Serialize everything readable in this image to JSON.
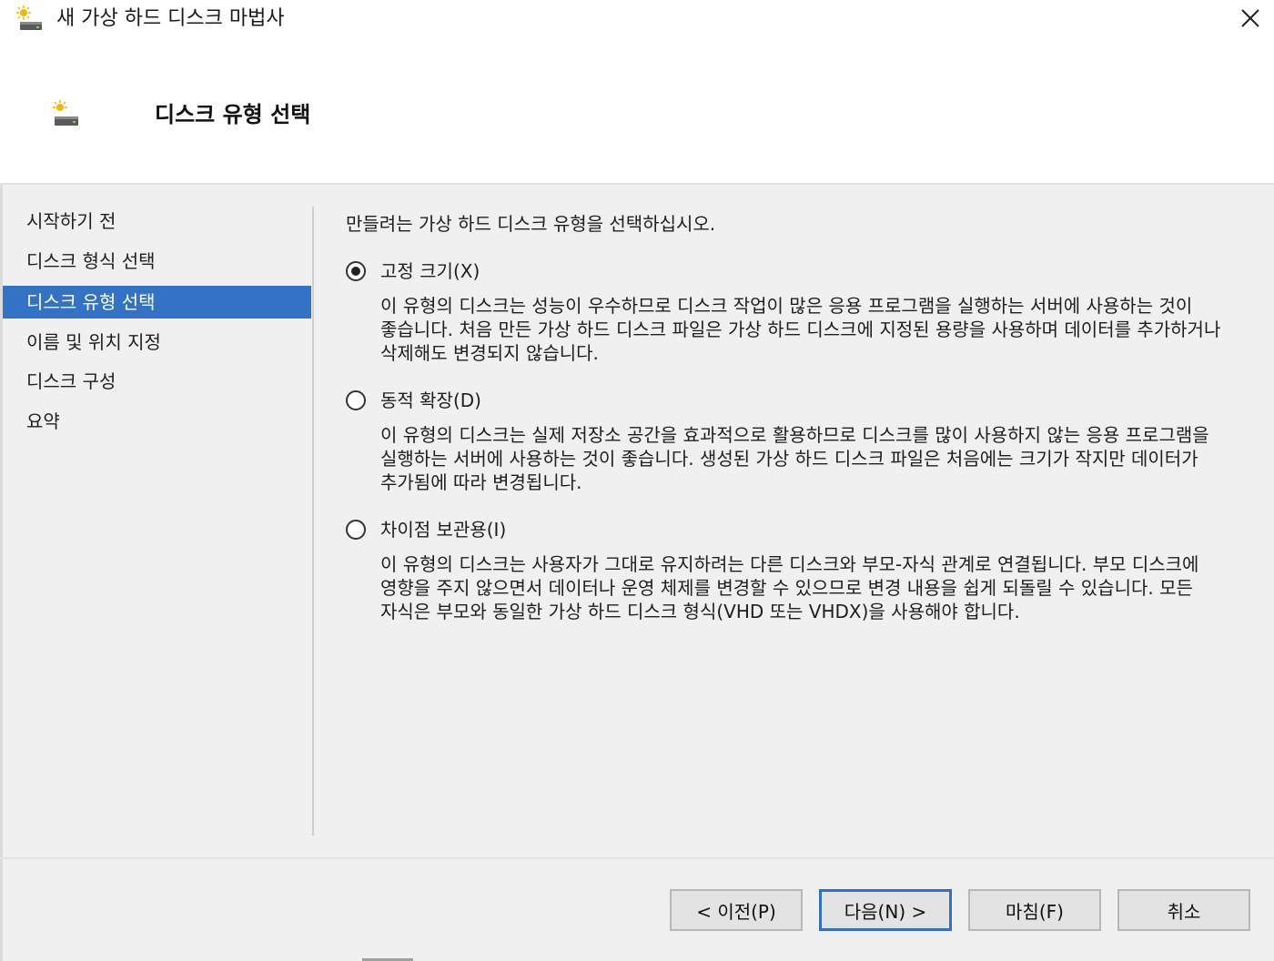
{
  "window": {
    "title": "새 가상 하드 디스크 마법사",
    "icon": "disk-wizard-icon"
  },
  "header": {
    "title": "디스크 유형 선택",
    "icon": "disk-wizard-icon"
  },
  "nav": {
    "items": [
      {
        "label": "시작하기 전",
        "active": false
      },
      {
        "label": "디스크 형식 선택",
        "active": false
      },
      {
        "label": "디스크 유형 선택",
        "active": true
      },
      {
        "label": "이름 및 위치 지정",
        "active": false
      },
      {
        "label": "디스크 구성",
        "active": false
      },
      {
        "label": "요약",
        "active": false
      }
    ]
  },
  "main": {
    "instruction": "만들려는 가상 하드 디스크 유형을 선택하십시오.",
    "options": [
      {
        "label": "고정 크기(X)",
        "checked": true,
        "description": "이 유형의 디스크는 성능이 우수하므로 디스크 작업이 많은 응용 프로그램을 실행하는 서버에 사용하는 것이 좋습니다. 처음 만든 가상 하드 디스크 파일은 가상 하드 디스크에 지정된 용량을 사용하며 데이터를 추가하거나 삭제해도 변경되지 않습니다."
      },
      {
        "label": "동적 확장(D)",
        "checked": false,
        "description": "이 유형의 디스크는 실제 저장소 공간을 효과적으로 활용하므로 디스크를 많이 사용하지 않는 응용 프로그램을 실행하는 서버에 사용하는 것이 좋습니다. 생성된 가상 하드 디스크 파일은 처음에는 크기가 작지만 데이터가 추가됨에 따라 변경됩니다."
      },
      {
        "label": "차이점 보관용(I)",
        "checked": false,
        "description": "이 유형의 디스크는 사용자가 그대로 유지하려는 다른 디스크와 부모-자식 관계로 연결됩니다. 부모 디스크에 영향을 주지 않으면서 데이터나 운영 체제를 변경할 수 있으므로 변경 내용을 쉽게 되돌릴 수 있습니다. 모든 자식은 부모와 동일한 가상 하드 디스크 형식(VHD 또는 VHDX)을 사용해야 합니다."
      }
    ]
  },
  "footer": {
    "previous_label": "< 이전(P)",
    "next_label": "다음(N) >",
    "finish_label": "마침(F)",
    "cancel_label": "취소"
  },
  "colors": {
    "nav_active_bg": "#3372c4",
    "primary_button_border": "#3270c4"
  }
}
